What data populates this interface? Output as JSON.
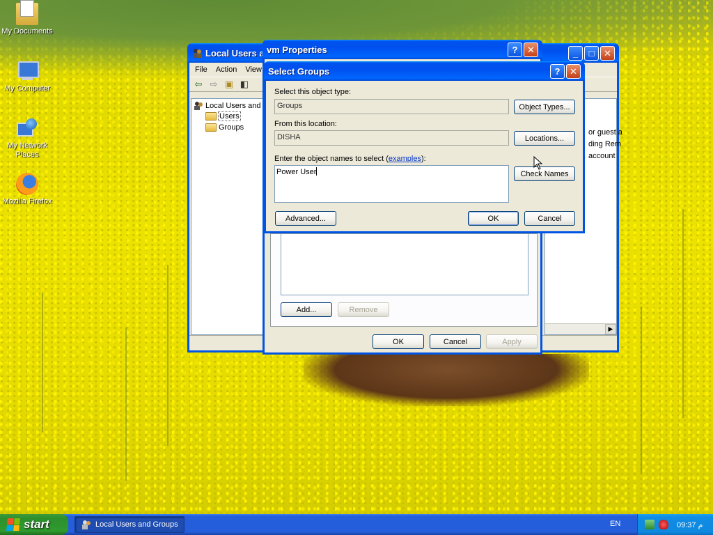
{
  "desktop": {
    "icons": [
      {
        "label": "My Documents",
        "icon": "my-documents-icon"
      },
      {
        "label": "My Computer",
        "icon": "my-computer-icon"
      },
      {
        "label": "My Network Places",
        "icon": "my-network-places-icon"
      },
      {
        "label": "Mozilla Firefox",
        "icon": "firefox-icon"
      }
    ]
  },
  "mmc": {
    "title": "Local Users and Groups",
    "menu": [
      "File",
      "Action",
      "View"
    ],
    "tree": {
      "root": "Local Users and Groups (Local)",
      "children": [
        "Users",
        "Groups"
      ]
    },
    "right_pane_text": [
      "or guest a",
      "ding Rem",
      "account"
    ]
  },
  "props": {
    "title": "vm Properties",
    "buttons": {
      "add": "Add...",
      "remove": "Remove",
      "ok": "OK",
      "cancel": "Cancel",
      "apply": "Apply"
    }
  },
  "select_groups": {
    "title": "Select Groups",
    "object_type_label": "Select this object type:",
    "object_type_value": "Groups",
    "object_types_button": "Object Types...",
    "location_label": "From this location:",
    "location_value": "DISHA",
    "locations_button": "Locations...",
    "names_label_prefix": "Enter the object names to select (",
    "names_label_link": "examples",
    "names_label_suffix": "):",
    "names_value": "Power User",
    "check_names_button": "Check Names",
    "advanced_button": "Advanced...",
    "ok_button": "OK",
    "cancel_button": "Cancel"
  },
  "taskbar": {
    "start_label": "start",
    "task_item": "Local Users and Groups",
    "language": "EN",
    "clock": "09:37 م"
  },
  "colors": {
    "title_blue": "#0054e3",
    "dialog_face": "#ece9d8",
    "taskbar_blue": "#245edb",
    "start_green": "#2f9b2f",
    "tray_blue": "#0f89e0"
  }
}
